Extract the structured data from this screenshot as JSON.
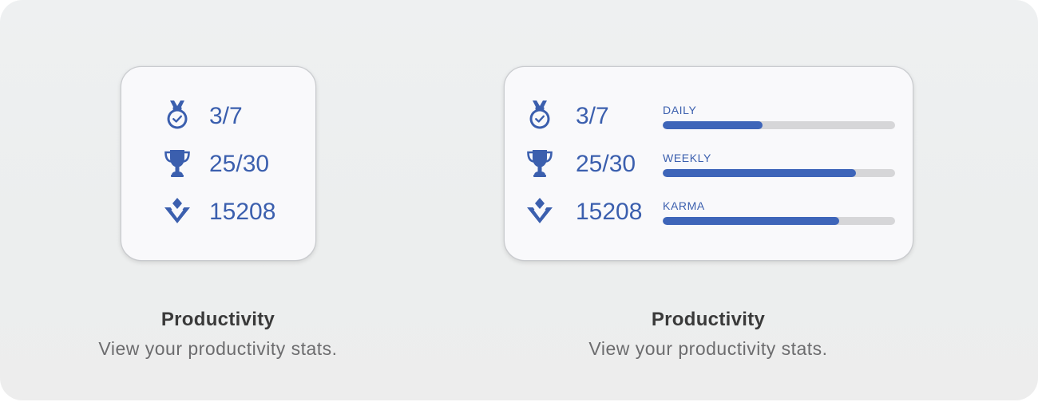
{
  "widgets": [
    {
      "size": "small",
      "stats": [
        {
          "icon": "medal-icon",
          "value": "3/7"
        },
        {
          "icon": "trophy-icon",
          "value": "25/30"
        },
        {
          "icon": "karma-icon",
          "value": "15208"
        }
      ],
      "caption": {
        "title": "Productivity",
        "subtitle": "View your productivity stats."
      }
    },
    {
      "size": "medium",
      "stats": [
        {
          "icon": "medal-icon",
          "value": "3/7",
          "bar_label": "DAILY",
          "progress": 0.43
        },
        {
          "icon": "trophy-icon",
          "value": "25/30",
          "bar_label": "WEEKLY",
          "progress": 0.83
        },
        {
          "icon": "karma-icon",
          "value": "15208",
          "bar_label": "KARMA",
          "progress": 0.76
        }
      ],
      "caption": {
        "title": "Productivity",
        "subtitle": "View your productivity stats."
      }
    }
  ],
  "colors": {
    "accent": "#3b5fae",
    "bar_fill": "#3e65b9",
    "bar_track": "#d6d6d8",
    "card_background": "#f9f9fb",
    "page_background": "#eceeee",
    "caption_title": "#3a3a3a",
    "caption_subtitle": "#6c6c6e"
  }
}
